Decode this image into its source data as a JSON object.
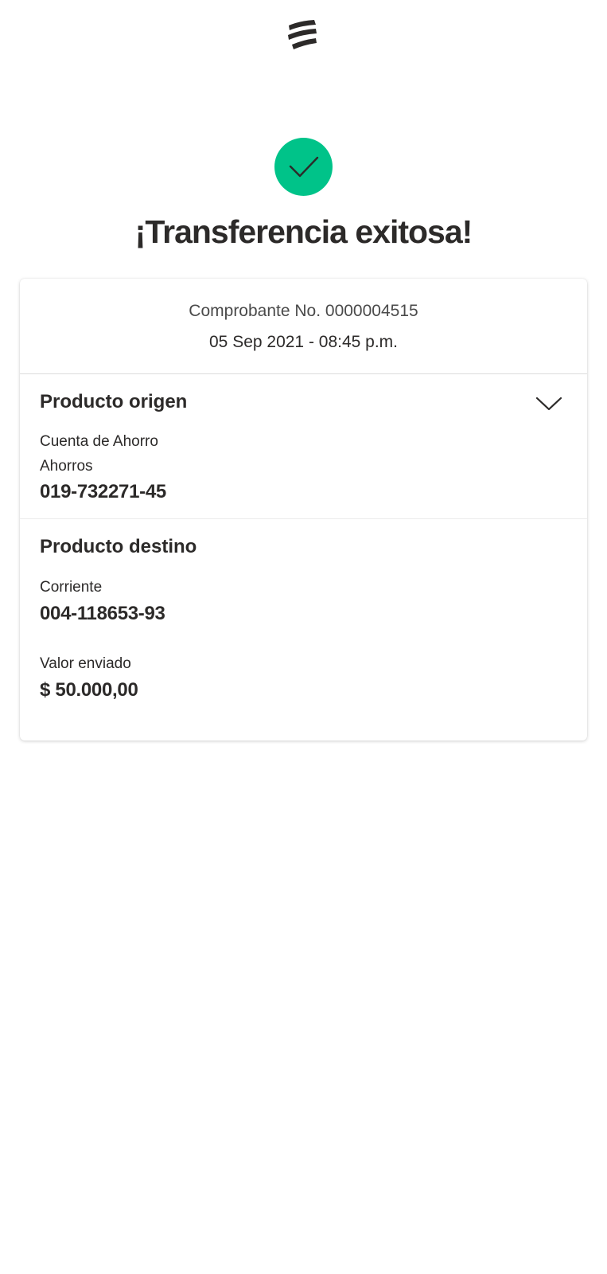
{
  "header": {
    "logo_icon": "bancolombia-logo-icon"
  },
  "status": {
    "icon": "check-icon",
    "color": "#00c389",
    "title": "¡Transferencia exitosa!"
  },
  "receipt": {
    "number_line": "Comprobante No. 0000004515",
    "datetime": "05 Sep 2021 - 08:45 p.m."
  },
  "origin": {
    "title": "Producto origen",
    "account_type": "Cuenta de Ahorro",
    "account_subtype": "Ahorros",
    "account_number": "019-732271-45",
    "toggle_icon": "chevron-down-icon"
  },
  "destination": {
    "title": "Producto destino",
    "account_type": "Corriente",
    "account_number": "004-118653-93",
    "amount_label": "Valor enviado",
    "amount_value": "$ 50.000,00"
  }
}
